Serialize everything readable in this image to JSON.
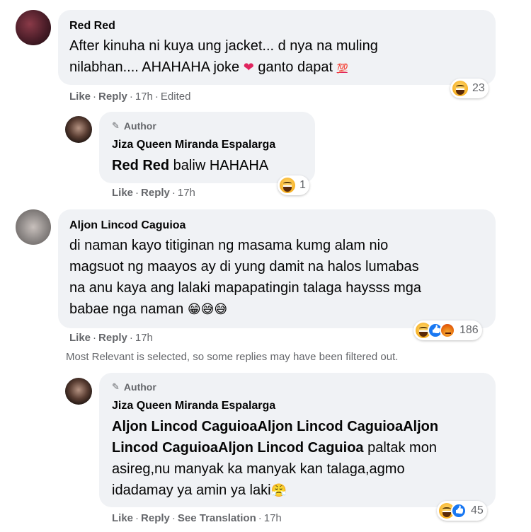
{
  "comments": {
    "c1": {
      "name": "Red Red",
      "text_line1": "After kinuha ni kuya ung jacket... d nya na muling",
      "text_line2a": "nilabhan.... AHAHAHA joke ",
      "text_line2b": " ganto dapat ",
      "emoji_heart": "❤",
      "emoji_hundred": "💯",
      "like": "Like",
      "reply": "Reply",
      "time": "17h",
      "edited": "Edited",
      "reaction_count": "23"
    },
    "r1": {
      "author_tag": "Author",
      "name": "Jiza Queen Miranda Espalarga",
      "mention": "Red Red",
      "text": " baliw HAHAHA",
      "like": "Like",
      "reply": "Reply",
      "time": "17h",
      "reaction_count": "1"
    },
    "c2": {
      "name": "Aljon Lincod Caguioa",
      "line1": "di naman kayo titiginan ng masama kumg alam nio",
      "line2": "magsuot ng maayos ay di yung damit na halos lumabas",
      "line3": "na anu kaya ang lalaki mapapatingin talaga haysss mga",
      "line4": "babae nga naman ",
      "emojis": "😁😅😅",
      "like": "Like",
      "reply": "Reply",
      "time": "17h",
      "reaction_count": "186"
    },
    "note": "Most Relevant is selected, so some replies may have been filtered out.",
    "r2": {
      "author_tag": "Author",
      "name": "Jiza Queen Miranda Espalarga",
      "mention_line1": "Aljon Lincod CaguioaAljon Lincod CaguioaAljon",
      "mention_line2": "Lincod CaguioaAljon Lincod Caguioa",
      "line2_rest": " paltak mon",
      "line3": "asireg,nu manyak ka manyak kan talaga,agmo",
      "line4": "idadamay ya amin ya laki",
      "line4_emoji": "😤",
      "like": "Like",
      "reply": "Reply",
      "see_translation": "See Translation",
      "time": "17h",
      "reaction_count": "45"
    }
  },
  "colors": {
    "bubble": "#f0f2f5",
    "secondary_text": "#65676b",
    "like_blue": "#1877f2"
  }
}
